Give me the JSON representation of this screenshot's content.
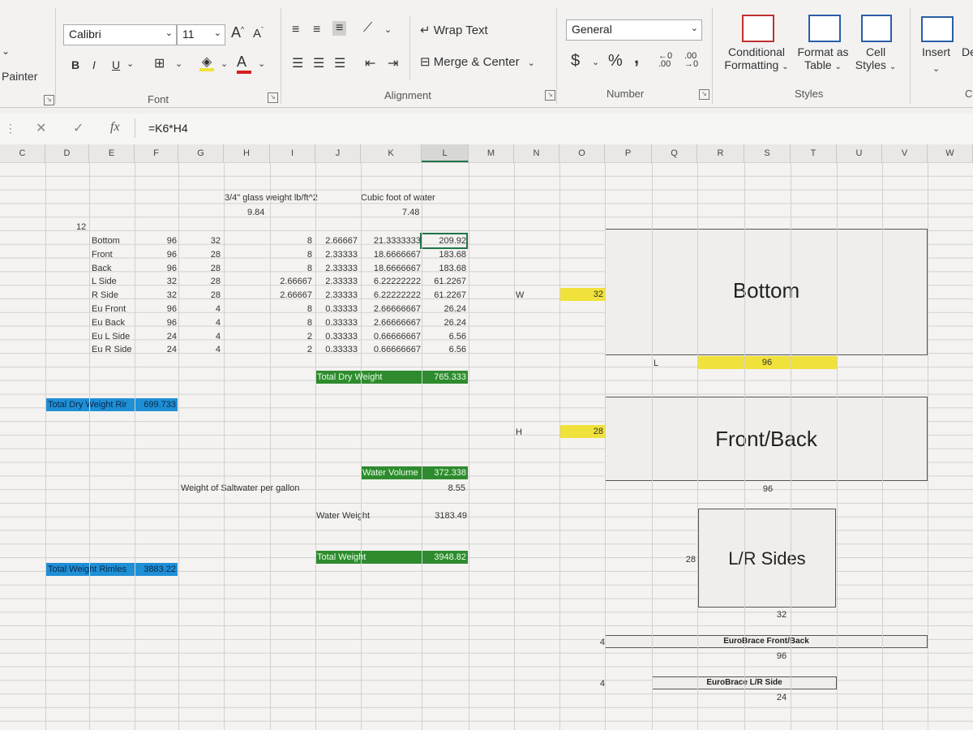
{
  "ribbon": {
    "painter_label": "Painter",
    "font": {
      "name": "Calibri",
      "size": "11",
      "grow": "A",
      "shrink": "A",
      "bold": "B",
      "italic": "I",
      "underline": "U",
      "font_color_letter": "A",
      "group_label": "Font"
    },
    "alignment": {
      "wrap_text": "Wrap Text",
      "merge_center": "Merge & Center",
      "group_label": "Alignment"
    },
    "number": {
      "format": "General",
      "currency": "$",
      "percent": "%",
      "comma": ",",
      "increase_decimal": "←0 .00",
      "decrease_decimal": ".00 →0",
      "group_label": "Number"
    },
    "styles": {
      "conditional": [
        "Conditional",
        "Formatting"
      ],
      "format_table": [
        "Format as",
        "Table"
      ],
      "cell_styles": [
        "Cell",
        "Styles"
      ],
      "group_label": "Styles"
    },
    "cells": {
      "insert": "Insert",
      "delete": "De",
      "group_label": "C"
    }
  },
  "formula_bar": {
    "fx": "fx",
    "formula": "=K6*H4"
  },
  "columns": [
    "C",
    "D",
    "E",
    "F",
    "G",
    "H",
    "I",
    "J",
    "K",
    "L",
    "M",
    "N",
    "O",
    "P",
    "Q",
    "R",
    "S",
    "T",
    "U",
    "V",
    "W"
  ],
  "selected_column": "L",
  "sheet": {
    "hdr_glass": "3/4\" glass weight lb/ft^2",
    "glass_weight": "9.84",
    "hdr_water": "Cubic foot of water",
    "water_value": "7.48",
    "d_value": "12",
    "rows": [
      {
        "name": "Bottom",
        "f": "96",
        "g": "32",
        "i": "",
        "j1": "8",
        "j2": "2.66667",
        "k": "21.3333333",
        "l": "209.92"
      },
      {
        "name": "Front",
        "f": "96",
        "g": "28",
        "i": "",
        "j1": "8",
        "j2": "2.33333",
        "k": "18.6666667",
        "l": "183.68"
      },
      {
        "name": "Back",
        "f": "96",
        "g": "28",
        "i": "",
        "j1": "8",
        "j2": "2.33333",
        "k": "18.6666667",
        "l": "183.68"
      },
      {
        "name": "L Side",
        "f": "32",
        "g": "28",
        "i": "2.66667",
        "j1": "",
        "j2": "2.33333",
        "k": "6.22222222",
        "l": "61.2267"
      },
      {
        "name": "R Side",
        "f": "32",
        "g": "28",
        "i": "2.66667",
        "j1": "",
        "j2": "2.33333",
        "k": "6.22222222",
        "l": "61.2267"
      },
      {
        "name": "Eu Front",
        "f": "96",
        "g": "4",
        "i": "",
        "j1": "8",
        "j2": "0.33333",
        "k": "2.66666667",
        "l": "26.24"
      },
      {
        "name": "Eu Back",
        "f": "96",
        "g": "4",
        "i": "",
        "j1": "8",
        "j2": "0.33333",
        "k": "2.66666667",
        "l": "26.24"
      },
      {
        "name": "Eu L Side",
        "f": "24",
        "g": "4",
        "i": "",
        "j1": "2",
        "j2": "0.33333",
        "k": "0.66666667",
        "l": "6.56"
      },
      {
        "name": "Eu R Side",
        "f": "24",
        "g": "4",
        "i": "",
        "j1": "2",
        "j2": "0.33333",
        "k": "0.66666667",
        "l": "6.56"
      }
    ],
    "total_dry_label": "Total Dry Weight",
    "total_dry_value": "765.333",
    "rimless_dry_label": "Total Dry Weight Rir",
    "rimless_dry_value": "699.733",
    "water_volume_label": "Water Volume",
    "water_volume_value": "372.338",
    "saltwater_label": "Weight of Saltwater per gallon",
    "saltwater_value": "8.55",
    "water_weight_label": "Water Weight",
    "water_weight_value": "3183.49",
    "total_weight_label": "Total Weight",
    "total_weight_value": "3948.82",
    "rimless_total_label": "Total Weight Rimles",
    "rimless_total_value": "3883.22"
  },
  "diagram": {
    "w_label": "W",
    "w_value": "32",
    "bottom_label": "Bottom",
    "l_label": "L",
    "l_value": "96",
    "h_label": "H",
    "h_value": "28",
    "frontback_label": "Front/Back",
    "frontback_width": "96",
    "lr_label": "L/R Sides",
    "lr_height": "28",
    "lr_width": "32",
    "euro_fb_height": "4",
    "euro_fb_label": "EuroBrace Front/Back",
    "euro_fb_width": "96",
    "euro_lr_height": "4",
    "euro_lr_label": "EuroBrace L/R Side",
    "euro_lr_width": "24"
  }
}
